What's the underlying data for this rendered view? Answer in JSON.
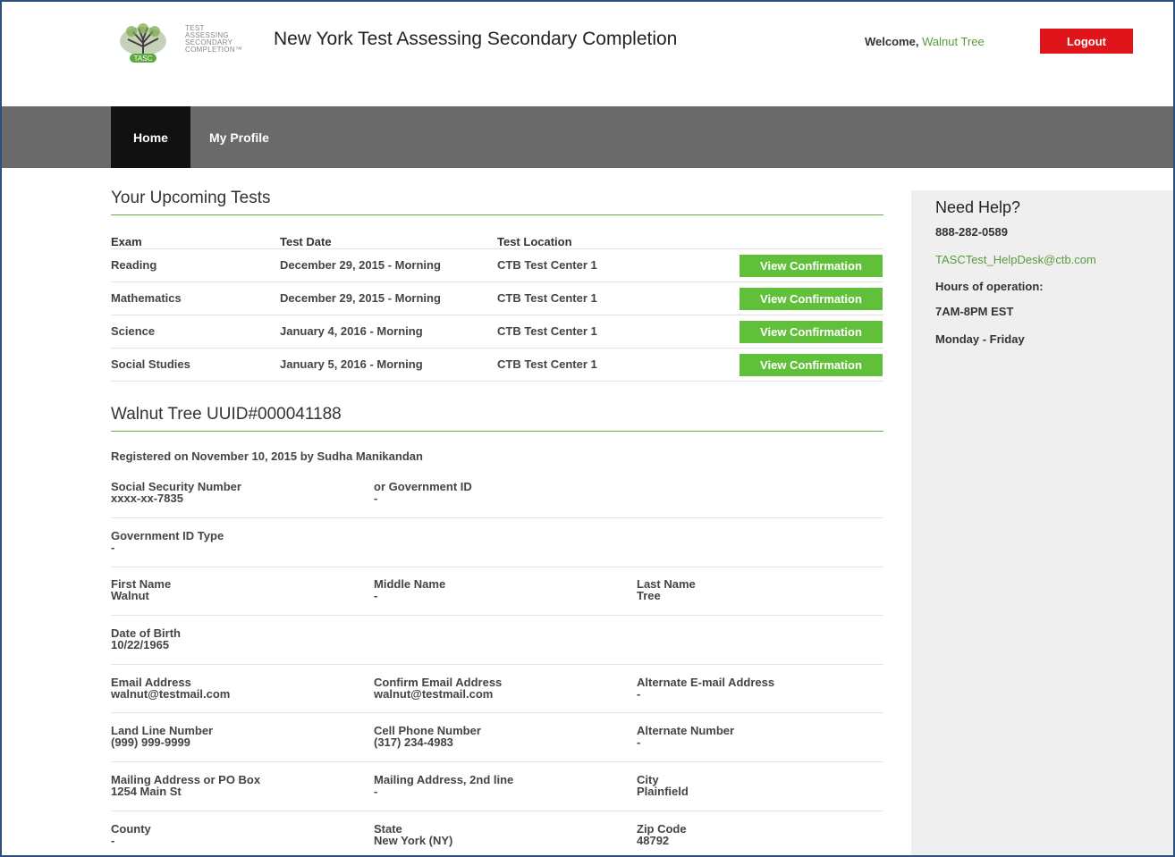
{
  "header": {
    "logo_text": [
      "TEST",
      "ASSESSING",
      "SECONDARY",
      "COMPLETION™"
    ],
    "logo_badge": "TASC",
    "title": "New York Test Assessing Secondary Completion",
    "welcome_prefix": "Welcome,",
    "user_name": "Walnut Tree",
    "logout_label": "Logout"
  },
  "nav": {
    "home": "Home",
    "profile": "My Profile"
  },
  "upcoming": {
    "title": "Your Upcoming Tests",
    "headers": {
      "exam": "Exam",
      "date": "Test Date",
      "location": "Test Location"
    },
    "rows": [
      {
        "exam": "Reading",
        "date": "December 29, 2015 - Morning",
        "location": "CTB Test Center 1",
        "action": "View Confirmation"
      },
      {
        "exam": "Mathematics",
        "date": "December 29, 2015 - Morning",
        "location": "CTB Test Center 1",
        "action": "View Confirmation"
      },
      {
        "exam": "Science",
        "date": "January 4, 2016 - Morning",
        "location": "CTB Test Center 1",
        "action": "View Confirmation"
      },
      {
        "exam": "Social Studies",
        "date": "January 5, 2016 - Morning",
        "location": "CTB Test Center 1",
        "action": "View Confirmation"
      }
    ]
  },
  "profile": {
    "title": "Walnut Tree UUID#000041188",
    "registered": "Registered on November 10, 2015 by Sudha Manikandan",
    "ssn_label": "Social Security Number",
    "ssn_value": "xxxx-xx-7835",
    "govid_label": "or Government ID",
    "govid_value": "-",
    "govtype_label": "Government ID Type",
    "govtype_value": "-",
    "first_label": "First Name",
    "first_value": "Walnut",
    "middle_label": "Middle Name",
    "middle_value": "-",
    "last_label": "Last Name",
    "last_value": "Tree",
    "dob_label": "Date of Birth",
    "dob_value": "10/22/1965",
    "email_label": "Email Address",
    "email_value": "walnut@testmail.com",
    "confirm_label": "Confirm Email Address",
    "confirm_value": "walnut@testmail.com",
    "altemail_label": "Alternate E-mail Address",
    "altemail_value": "-",
    "landline_label": "Land Line Number",
    "landline_value": "(999) 999-9999",
    "cell_label": "Cell Phone Number",
    "cell_value": "(317) 234-4983",
    "altnum_label": "Alternate Number",
    "altnum_value": "-",
    "mail1_label": "Mailing Address or PO Box",
    "mail1_value": "1254 Main St",
    "mail2_label": "Mailing Address, 2nd line",
    "mail2_value": "-",
    "city_label": "City",
    "city_value": "Plainfield",
    "county_label": "County",
    "county_value": "-",
    "state_label": "State",
    "state_value": "New York (NY)",
    "zip_label": "Zip Code",
    "zip_value": "48792"
  },
  "help": {
    "title": "Need Help?",
    "phone": "888-282-0589",
    "email": "TASCTest_HelpDesk@ctb.com",
    "hours_label": "Hours of operation:",
    "hours": "7AM-8PM EST",
    "days": "Monday - Friday"
  },
  "colors": {
    "accent_green": "#61c03a",
    "logout_red": "#e0141b",
    "nav_gray": "#6a6a6a"
  }
}
